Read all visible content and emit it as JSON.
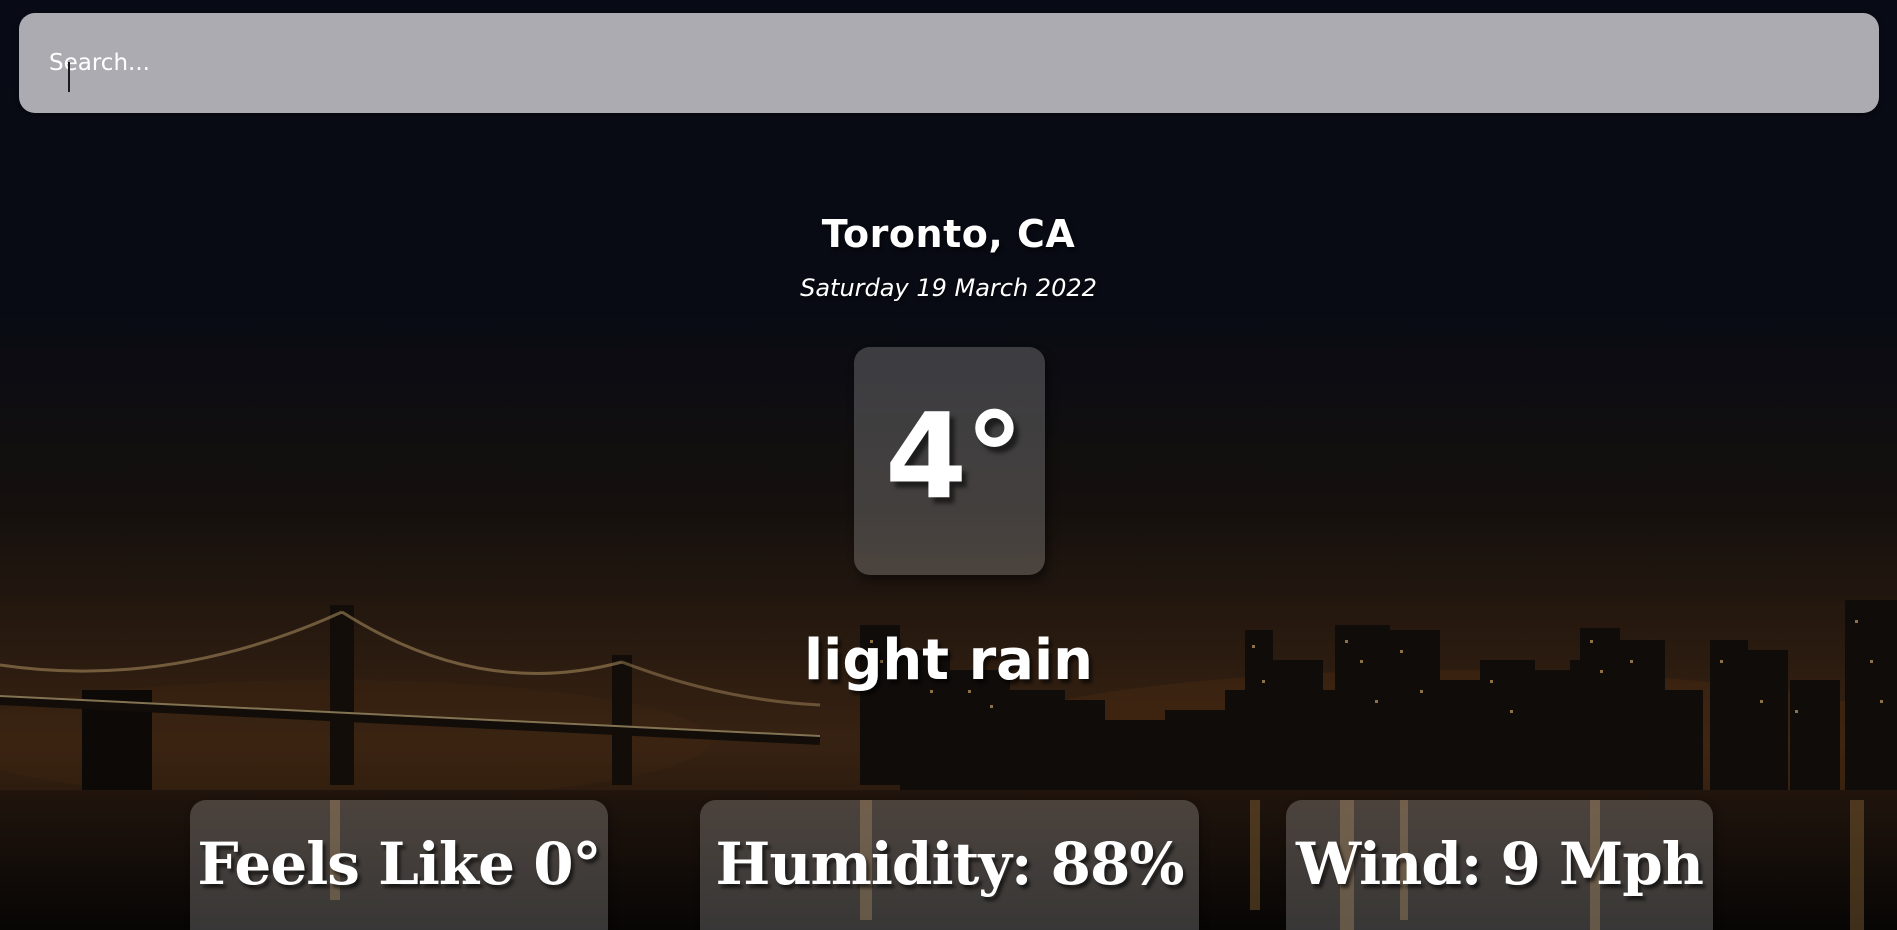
{
  "search": {
    "placeholder": "Search..."
  },
  "weather": {
    "location": "Toronto, CA",
    "date": "Saturday 19 March 2022",
    "temperature": "4°",
    "condition": "light rain",
    "feels_like": "Feels Like 0°",
    "humidity": "Humidity: 88%",
    "wind": "Wind: 9 Mph"
  },
  "colors": {
    "sky_top": "#0b0e1c",
    "sky_glow": "#3a2418",
    "search_bg": "#c8c6cc",
    "card_bg": "rgba(255,255,255,0.2)",
    "text": "#ffffff"
  },
  "background": {
    "scene": "night city skyline with suspension bridge reflected in water"
  }
}
